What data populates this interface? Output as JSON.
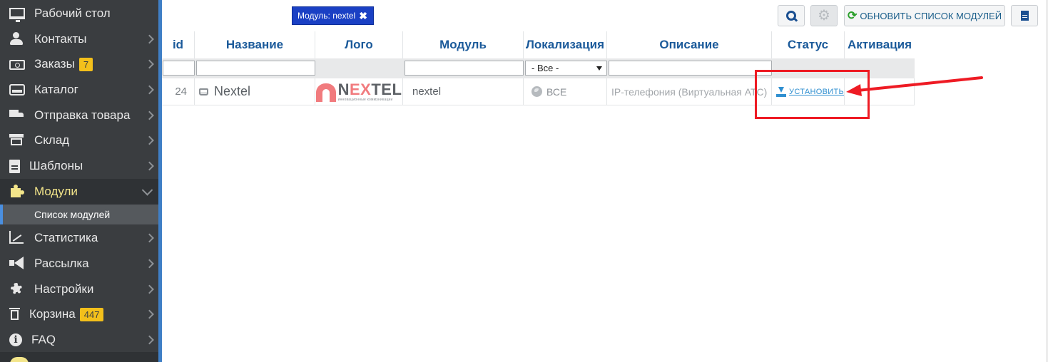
{
  "sidebar": {
    "items": [
      {
        "label": "Рабочий стол",
        "icon": "monitor-icon"
      },
      {
        "label": "Контакты",
        "icon": "users-icon"
      },
      {
        "label": "Заказы",
        "icon": "money-icon",
        "badge": "7"
      },
      {
        "label": "Каталог",
        "icon": "inbox-icon"
      },
      {
        "label": "Отправка товара",
        "icon": "truck-icon"
      },
      {
        "label": "Склад",
        "icon": "archive-icon"
      },
      {
        "label": "Шаблоны",
        "icon": "file-icon"
      },
      {
        "label": "Модули",
        "icon": "puzzle-icon",
        "active": true
      },
      {
        "label": "Статистика",
        "icon": "line-chart-icon"
      },
      {
        "label": "Рассылка",
        "icon": "bullhorn-icon"
      },
      {
        "label": "Настройки",
        "icon": "gear-icon"
      },
      {
        "label": "Корзина",
        "icon": "trash-icon",
        "badge": "447"
      },
      {
        "label": "FAQ",
        "icon": "info-icon"
      }
    ],
    "sub_item": "Список модулей"
  },
  "toolbar": {
    "filter_tag": "Модуль: nextel",
    "filter_tag_close": "✖",
    "refresh_label": "ОБНОВИТЬ СПИСОК МОДУЛЕЙ"
  },
  "table": {
    "columns": [
      "id",
      "Название",
      "Лого",
      "Модуль",
      "Локализация",
      "Описание",
      "Статус",
      "Активация"
    ],
    "localization_filter": "- Все -",
    "rows": [
      {
        "id": "24",
        "name": "Nextel",
        "logo_word_a": "N",
        "logo_word_b": "EX",
        "logo_word_c": "TEL",
        "logo_subtitle": "инновационные коммуникации",
        "module": "nextel",
        "localization": "ВСЕ",
        "description": "IP-телефония (Виртуальная АТС)",
        "status_action": "УСТАНОВИТЬ"
      }
    ]
  },
  "colors": {
    "sidebar_bg": "#3a3d40",
    "accent_blue": "#1b5a9a",
    "active_yellow": "#f3e58a",
    "badge_yellow": "#f3c01b",
    "annotation_red": "#ee1b24"
  }
}
